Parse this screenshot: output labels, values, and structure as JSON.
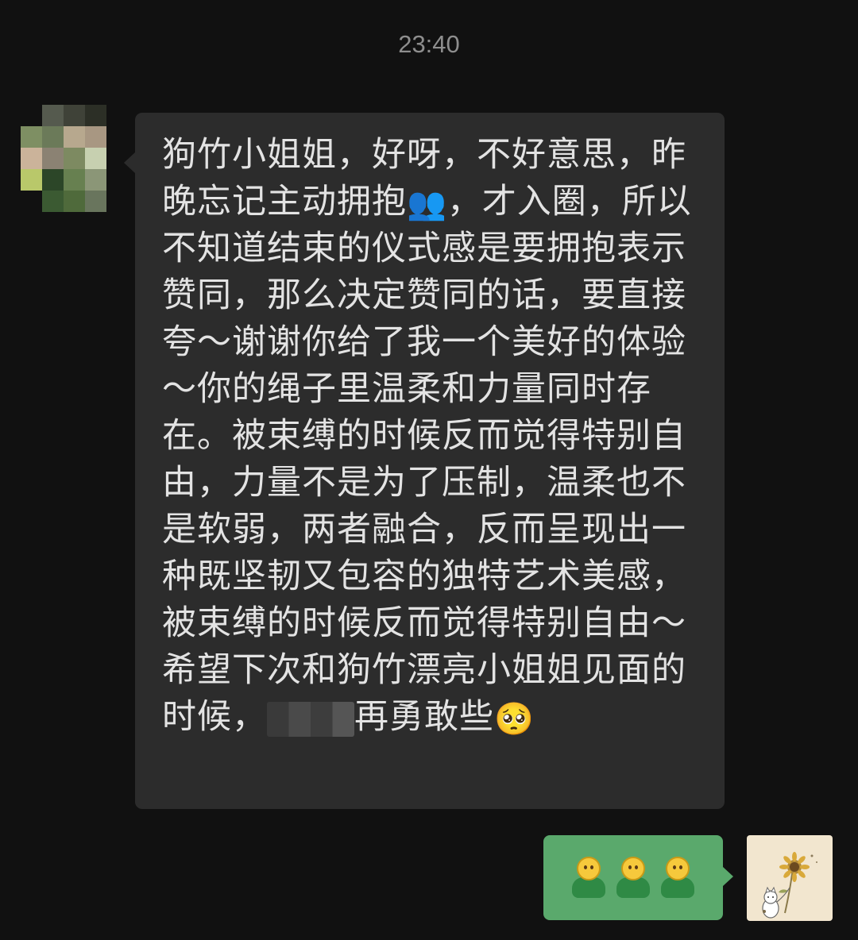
{
  "header": {
    "time": "23:40"
  },
  "incoming_message": {
    "sender_avatar": "pixelated-avatar",
    "text_part_1": "狗竹小姐姐，好呀，不好意思，昨晚忘记主动拥抱",
    "emoji_1": "👥",
    "text_part_2": "，才入圈，所以不知道结束的仪式感是要拥抱表示赞同，那么决定赞同的话，要直接夸～谢谢你给了我一个美好的体验～你的绳子里温柔和力量同时存在。被束缚的时候反而觉得特别自由，力量不是为了压制，温柔也不是软弱，两者融合，反而呈现出一种既坚韧又包容的独特艺术美感，被束缚的时候反而觉得特别自由～希望下次和狗竹漂亮小姐姐见面的时候，",
    "text_part_3": "再勇敢些",
    "emoji_2": "🥺"
  },
  "outgoing_message": {
    "emoji_count": 3,
    "emoji_name": "green-person-emoji",
    "avatar": "sunflower-cat-avatar"
  },
  "colors": {
    "background": "#111111",
    "incoming_bubble": "#2c2c2c",
    "outgoing_bubble": "#5aa96c",
    "text": "#e3e3e3",
    "time": "#8e8e8e"
  }
}
